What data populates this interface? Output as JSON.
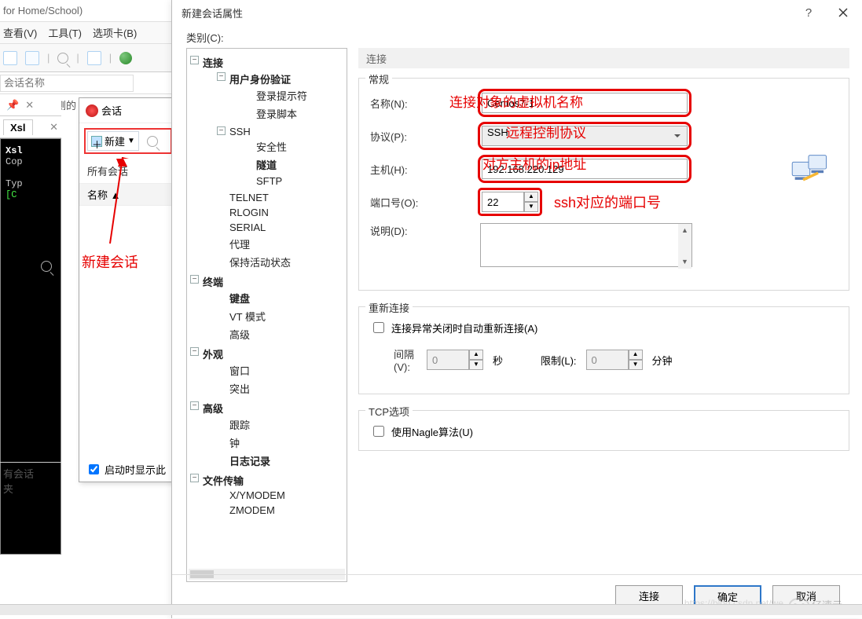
{
  "bg": {
    "title_suffix": "for Home/School)",
    "menu": {
      "view": "查看(V)",
      "tools": "工具(T)",
      "tab": "选项卡(B)"
    },
    "address_placeholder": "会话名称",
    "hint_text": "话，点击左侧的"
  },
  "terminal": {
    "tab_label": "Xsl",
    "line_copy": "Cop",
    "line_typ": "Typ",
    "line_prompt": "[C"
  },
  "sessions_panel": {
    "title": "会话",
    "new_label": "新建",
    "all_sessions_label": "所有会话",
    "col_name": "名称 ▲",
    "startup_show": "启动时显示此"
  },
  "left_faint": {
    "l1": "有会话",
    "l2": "夹"
  },
  "annotations": {
    "new_session": "新建会话",
    "vm_name": "连接对象的虚拟机名称",
    "remote_proto": "远程控制协议",
    "host_ip": "对方主机的ip地址",
    "ssh_port": "ssh对应的端口号"
  },
  "dialog": {
    "title": "新建会话属性",
    "category_label": "类别(C):",
    "tree": {
      "connection": "连接",
      "auth": "用户身份验证",
      "login_prompt": "登录提示符",
      "login_script": "登录脚本",
      "ssh": "SSH",
      "security": "安全性",
      "tunnel": "隧道",
      "sftp": "SFTP",
      "telnet": "TELNET",
      "rlogin": "RLOGIN",
      "serial": "SERIAL",
      "proxy": "代理",
      "keepalive": "保持活动状态",
      "terminal": "终端",
      "keyboard": "键盘",
      "vtmode": "VT 模式",
      "advanced_term": "高级",
      "appearance": "外观",
      "window": "窗口",
      "highlight": "突出",
      "advanced": "高级",
      "trace": "跟踪",
      "bell": "钟",
      "logging": "日志记录",
      "filetransfer": "文件传输",
      "xymodem": "X/YMODEM",
      "zmodem": "ZMODEM"
    },
    "header": "连接",
    "general": {
      "legend": "常规",
      "name_label": "名称(N):",
      "name_value": "Centos7-1",
      "protocol_label": "协议(P):",
      "protocol_value": "SSH",
      "host_label": "主机(H):",
      "host_value": "192.168.220.129",
      "port_label": "端口号(O):",
      "port_value": "22",
      "desc_label": "说明(D):"
    },
    "reconnect": {
      "legend": "重新连接",
      "auto_label": "连接异常关闭时自动重新连接(A)",
      "interval_label": "间隔(V):",
      "interval_value": "0",
      "seconds": "秒",
      "limit_label": "限制(L):",
      "limit_value": "0",
      "minutes": "分钟"
    },
    "tcp": {
      "legend": "TCP选项",
      "nagle_label": "使用Nagle算法(U)"
    },
    "buttons": {
      "connect": "连接",
      "ok": "确定",
      "cancel": "取消"
    }
  },
  "watermark_text": "亿速云",
  "faint_url": "https://blog.csdn.net/we"
}
